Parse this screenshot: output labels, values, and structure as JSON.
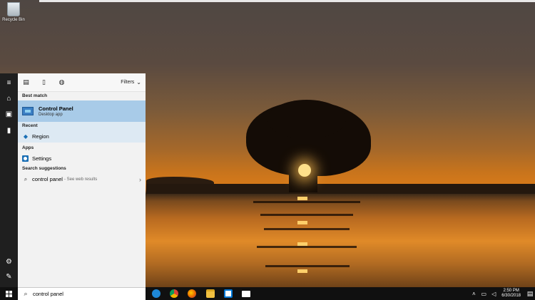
{
  "desktop": {
    "recycle_bin_label": "Recycle Bin"
  },
  "search_panel": {
    "filters_label": "Filters",
    "best_match": {
      "heading": "Best match",
      "title": "Control Panel",
      "subtitle": "Desktop app"
    },
    "recent": {
      "heading": "Recent",
      "items": [
        {
          "label": "Region"
        }
      ]
    },
    "apps": {
      "heading": "Apps",
      "items": [
        {
          "label": "Settings"
        }
      ]
    },
    "suggestions": {
      "heading": "Search suggestions",
      "items": [
        {
          "label": "control panel",
          "note": "- See web results"
        }
      ]
    }
  },
  "search_box": {
    "value": "control panel"
  },
  "taskbar": {
    "apps": [
      "edge-icon",
      "chrome-icon",
      "firefox-icon",
      "file-explorer-icon",
      "store-icon",
      "mail-icon"
    ],
    "clock": {
      "time": "2:50 PM",
      "date": "6/30/2018"
    }
  },
  "colors": {
    "selection": "#a8cbe8",
    "recent_bg": "#dde9f3",
    "taskbar": "#101010",
    "rail": "#1f1f1f",
    "accent": "#1a6fb5"
  }
}
